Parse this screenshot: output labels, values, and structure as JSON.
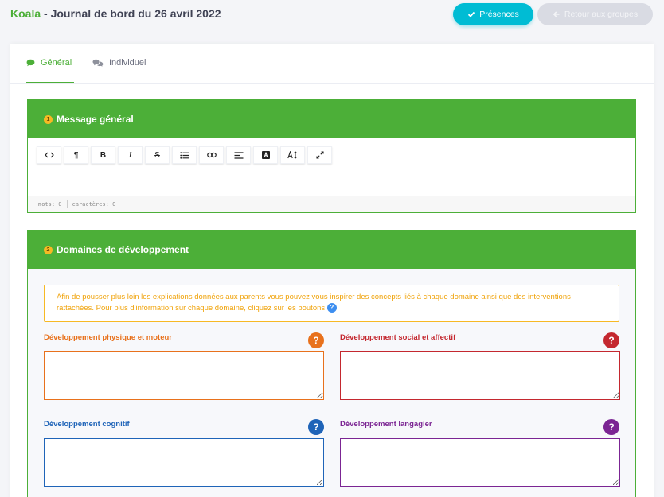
{
  "header": {
    "group_name": "Koala",
    "title_rest": " - Journal de bord du 26 avril 2022",
    "presences_label": "Présences",
    "retour_label": "Retour aux groupes"
  },
  "tabs": {
    "general": "Général",
    "individuel": "Individuel"
  },
  "section1": {
    "number": "1",
    "title": "Message général",
    "toolbar": [
      "<>",
      "¶",
      "B",
      "I",
      "S",
      "list",
      "link",
      "align",
      "A-color",
      "A-size",
      "fullscreen"
    ],
    "footer_words": "mots: 0",
    "footer_chars": "caractères: 0"
  },
  "section2": {
    "number": "2",
    "title": "Domaines de développement",
    "info_text": "Afin de pousser plus loin les explications données aux parents vous pouvez vous inspirer des concepts liés à chaque domaine ainsi que des interventions rattachées. Pour plus d'information sur chaque domaine, cliquez sur les boutons",
    "info_q": "?",
    "fields": [
      {
        "label": "Développement physique et moteur",
        "color": "#e8711c",
        "help": "?"
      },
      {
        "label": "Développement social et affectif",
        "color": "#c4282f",
        "help": "?"
      },
      {
        "label": "Développement cognitif",
        "color": "#1f64b8",
        "help": "?"
      },
      {
        "label": "Développement langagier",
        "color": "#7b2593",
        "help": "?"
      }
    ]
  },
  "colors": {
    "brand_green": "#4caf38",
    "cyan": "#00bcd4",
    "warning": "#f7b924"
  }
}
